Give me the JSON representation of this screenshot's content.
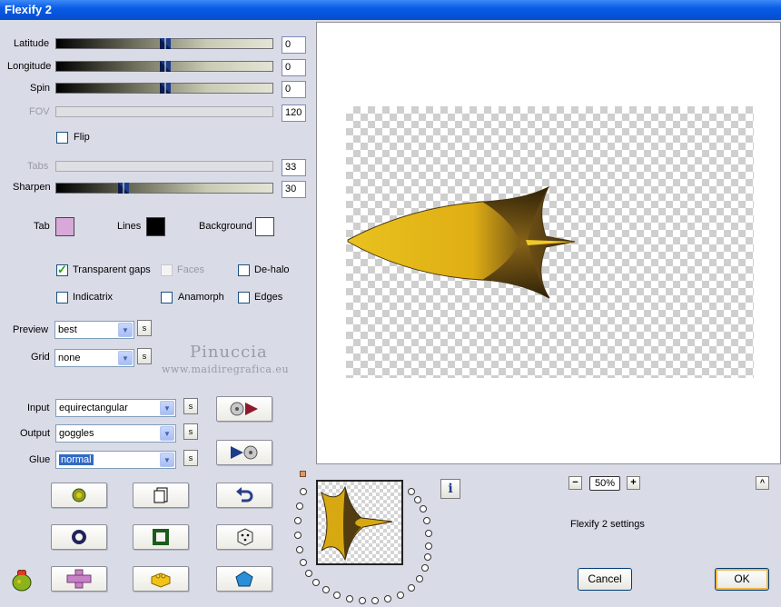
{
  "window": {
    "title": "Flexify 2"
  },
  "sliders": [
    {
      "label": "Latitude",
      "value": "0",
      "enabled": true,
      "position": 0.5
    },
    {
      "label": "Longitude",
      "value": "0",
      "enabled": true,
      "position": 0.5
    },
    {
      "label": "Spin",
      "value": "0",
      "enabled": true,
      "position": 0.5
    },
    {
      "label": "FOV",
      "value": "120",
      "enabled": false
    },
    {
      "label": "Tabs",
      "value": "33",
      "enabled": false
    },
    {
      "label": "Sharpen",
      "value": "30",
      "enabled": true,
      "position": 0.3
    }
  ],
  "flip": {
    "label": "Flip",
    "checked": false
  },
  "colors": {
    "tab_label": "Tab",
    "tab_color": "#d8a9d8",
    "lines_label": "Lines",
    "lines_color": "#000000",
    "background_label": "Background",
    "background_color": "#ffffff"
  },
  "options": {
    "transparent_gaps": {
      "label": "Transparent gaps",
      "checked": true
    },
    "faces": {
      "label": "Faces",
      "checked": false,
      "enabled": false
    },
    "de_halo": {
      "label": "De-halo",
      "checked": false
    },
    "indicatrix": {
      "label": "Indicatrix",
      "checked": false
    },
    "anamorph": {
      "label": "Anamorph",
      "checked": false
    },
    "edges": {
      "label": "Edges",
      "checked": false
    }
  },
  "preview_select": {
    "label": "Preview",
    "value": "best"
  },
  "grid_select": {
    "label": "Grid",
    "value": "none"
  },
  "input_select": {
    "label": "Input",
    "value": "equirectangular"
  },
  "output_select": {
    "label": "Output",
    "value": "goggles"
  },
  "glue_select": {
    "label": "Glue",
    "value": "normal"
  },
  "small_button_label": "s",
  "watermark": {
    "name": "Pinuccia",
    "url": "www.maidiregrafica.eu"
  },
  "zoom": {
    "value": "50%",
    "minus": "−",
    "plus": "+"
  },
  "collapse_button": "^",
  "info_button": "i",
  "status_text": "Flexify 2 settings",
  "buttons": {
    "cancel": "Cancel",
    "ok": "OK"
  },
  "accent_colors": {
    "title_bar": "#0a5ce6",
    "shape_yellow": "#e3b31c",
    "shape_dark": "#3a2a10"
  }
}
